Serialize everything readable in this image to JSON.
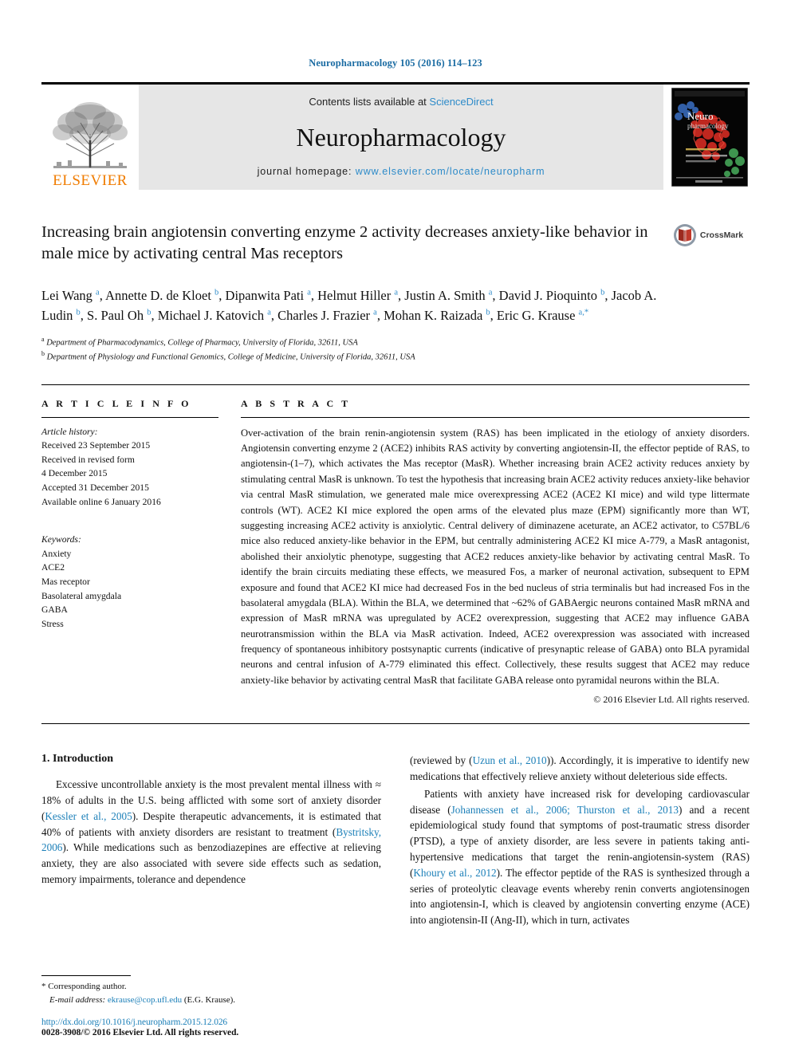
{
  "journal_ref": "Neuropharmacology 105 (2016) 114–123",
  "masthead": {
    "publisher_name": "ELSEVIER",
    "contents_prefix": "Contents lists available at ",
    "contents_link": "ScienceDirect",
    "journal_name": "Neuropharmacology",
    "homepage_prefix": "journal homepage: ",
    "homepage_url": "www.elsevier.com/locate/neuropharm",
    "cover_title_line1": "Neuro",
    "cover_title_line2": "pharmacology"
  },
  "article": {
    "title": "Increasing brain angiotensin converting enzyme 2 activity decreases anxiety-like behavior in male mice by activating central Mas receptors",
    "crossmark_label": "CrossMark",
    "authors": [
      {
        "name": "Lei Wang",
        "sup": "a",
        "sep": ", "
      },
      {
        "name": "Annette D. de Kloet",
        "sup": "b",
        "sep": ", "
      },
      {
        "name": "Dipanwita Pati",
        "sup": "a",
        "sep": ", "
      },
      {
        "name": "Helmut Hiller",
        "sup": "a",
        "sep": ", "
      },
      {
        "name": "Justin A. Smith",
        "sup": "a",
        "sep": ", "
      },
      {
        "name": "David J. Pioquinto",
        "sup": "b",
        "sep": ", "
      },
      {
        "name": "Jacob A. Ludin",
        "sup": "b",
        "sep": ", "
      },
      {
        "name": "S. Paul Oh",
        "sup": "b",
        "sep": ", "
      },
      {
        "name": "Michael J. Katovich",
        "sup": "a",
        "sep": ", "
      },
      {
        "name": "Charles J. Frazier",
        "sup": "a",
        "sep": ", "
      },
      {
        "name": "Mohan K. Raizada",
        "sup": "b",
        "sep": ", "
      },
      {
        "name": "Eric G. Krause",
        "sup": "a,*",
        "sep": ""
      }
    ],
    "affiliations": [
      {
        "marker": "a",
        "text": "Department of Pharmacodynamics, College of Pharmacy, University of Florida, 32611, USA"
      },
      {
        "marker": "b",
        "text": "Department of Physiology and Functional Genomics, College of Medicine, University of Florida, 32611, USA"
      }
    ]
  },
  "article_info": {
    "heading": "A R T I C L E  I N F O",
    "history_label": "Article history:",
    "history": [
      "Received 23 September 2015",
      "Received in revised form",
      "4 December 2015",
      "Accepted 31 December 2015",
      "Available online 6 January 2016"
    ],
    "keywords_label": "Keywords:",
    "keywords": [
      "Anxiety",
      "ACE2",
      "Mas receptor",
      "Basolateral amygdala",
      "GABA",
      "Stress"
    ]
  },
  "abstract": {
    "heading": "A B S T R A C T",
    "text": "Over-activation of the brain renin-angiotensin system (RAS) has been implicated in the etiology of anxiety disorders. Angiotensin converting enzyme 2 (ACE2) inhibits RAS activity by converting angiotensin-II, the effector peptide of RAS, to angiotensin-(1–7), which activates the Mas receptor (MasR). Whether increasing brain ACE2 activity reduces anxiety by stimulating central MasR is unknown. To test the hypothesis that increasing brain ACE2 activity reduces anxiety-like behavior via central MasR stimulation, we generated male mice overexpressing ACE2 (ACE2 KI mice) and wild type littermate controls (WT). ACE2 KI mice explored the open arms of the elevated plus maze (EPM) significantly more than WT, suggesting increasing ACE2 activity is anxiolytic. Central delivery of diminazene aceturate, an ACE2 activator, to C57BL/6 mice also reduced anxiety-like behavior in the EPM, but centrally administering ACE2 KI mice A-779, a MasR antagonist, abolished their anxiolytic phenotype, suggesting that ACE2 reduces anxiety-like behavior by activating central MasR. To identify the brain circuits mediating these effects, we measured Fos, a marker of neuronal activation, subsequent to EPM exposure and found that ACE2 KI mice had decreased Fos in the bed nucleus of stria terminalis but had increased Fos in the basolateral amygdala (BLA). Within the BLA, we determined that ~62% of GABAergic neurons contained MasR mRNA and expression of MasR mRNA was upregulated by ACE2 overexpression, suggesting that ACE2 may influence GABA neurotransmission within the BLA via MasR activation. Indeed, ACE2 overexpression was associated with increased frequency of spontaneous inhibitory postsynaptic currents (indicative of presynaptic release of GABA) onto BLA pyramidal neurons and central infusion of A-779 eliminated this effect. Collectively, these results suggest that ACE2 may reduce anxiety-like behavior by activating central MasR that facilitate GABA release onto pyramidal neurons within the BLA.",
    "copyright": "© 2016 Elsevier Ltd. All rights reserved."
  },
  "introduction": {
    "heading": "1. Introduction",
    "left_paragraph_part1": "Excessive uncontrollable anxiety is the most prevalent mental illness with ≈ 18% of adults in the U.S. being afflicted with some sort of anxiety disorder (",
    "left_cite1": "Kessler et al., 2005",
    "left_paragraph_part2": "). Despite therapeutic advancements, it is estimated that 40% of patients with anxiety disorders are resistant to treatment (",
    "left_cite2": "Bystritsky, 2006",
    "left_paragraph_part3": "). While medications such as benzodiazepines are effective at relieving anxiety, they are also associated with severe side effects such as sedation, memory impairments, tolerance and dependence",
    "right_paragraph1_part1": "(reviewed by (",
    "right_cite1": "Uzun et al., 2010",
    "right_paragraph1_part2": ")). Accordingly, it is imperative to identify new medications that effectively relieve anxiety without deleterious side effects.",
    "right_paragraph2_part1": "Patients with anxiety have increased risk for developing cardiovascular disease (",
    "right_cite2": "Johannessen et al., 2006; Thurston et al., 2013",
    "right_paragraph2_part2": ") and a recent epidemiological study found that symptoms of post-traumatic stress disorder (PTSD), a type of anxiety disorder, are less severe in patients taking anti-hypertensive medications that target the renin-angiotensin-system (RAS) (",
    "right_cite3": "Khoury et al., 2012",
    "right_paragraph2_part3": "). The effector peptide of the RAS is synthesized through a series of proteolytic cleavage events whereby renin converts angiotensinogen into angiotensin-I, which is cleaved by angiotensin converting enzyme (ACE) into angiotensin-II (Ang-II), which in turn, activates"
  },
  "footer": {
    "corresponding_marker": "*",
    "corresponding_label": "Corresponding author.",
    "email_label": "E-mail address:",
    "email": "ekrause@cop.ufl.edu",
    "email_owner": "(E.G. Krause).",
    "doi": "http://dx.doi.org/10.1016/j.neuropharm.2015.12.026",
    "issn": "0028-3908/© 2016 Elsevier Ltd. All rights reserved."
  },
  "colors": {
    "link_blue": "#1b7fb8",
    "science_direct_blue": "#2e8bc9",
    "elsevier_orange": "#f07c00",
    "banner_gray": "#e6e6e6"
  }
}
